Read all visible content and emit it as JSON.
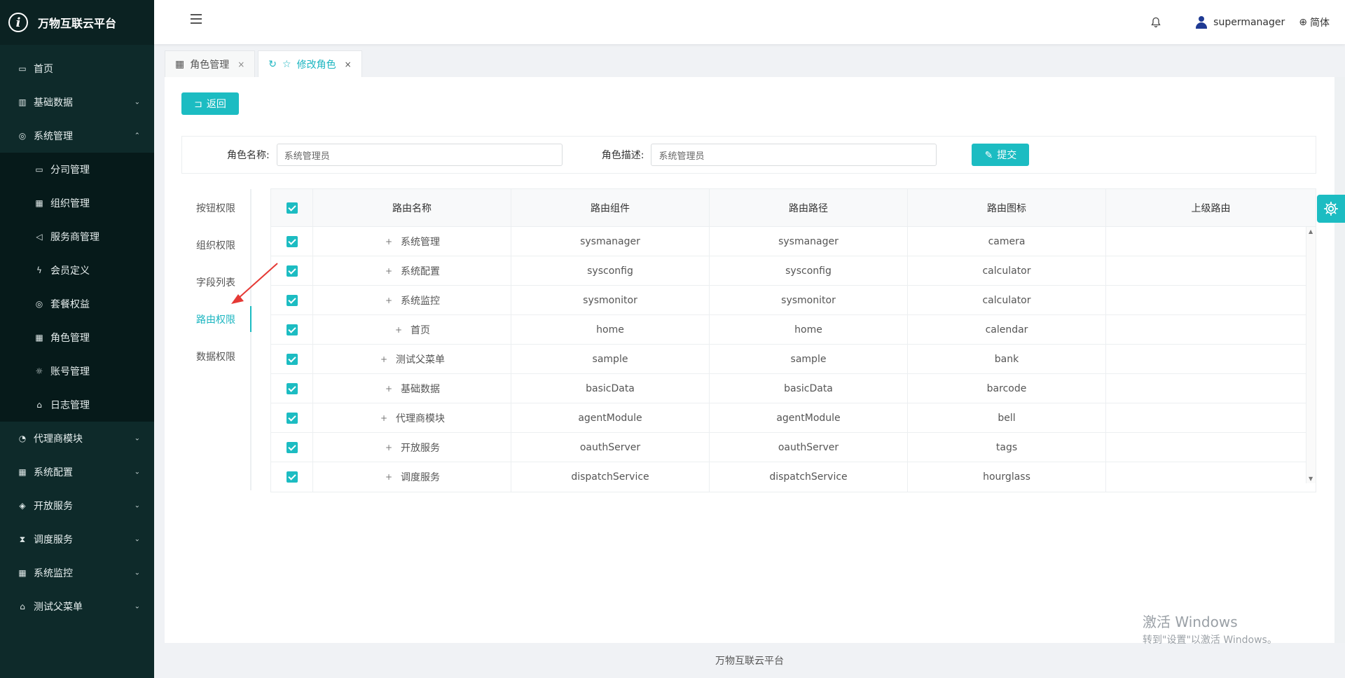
{
  "brand": {
    "logo_letter": "i",
    "title": "万物互联云平台"
  },
  "sidebar": {
    "items": [
      {
        "label": "首页",
        "icon": "calendar-icon",
        "glyph": "▭"
      },
      {
        "label": "基础数据",
        "icon": "barcode-icon",
        "glyph": "▥",
        "chevron": "⌄"
      },
      {
        "label": "系统管理",
        "icon": "camera-icon",
        "glyph": "◎",
        "chevron": "⌃",
        "expanded": true
      },
      {
        "label": "代理商模块",
        "icon": "bell-icon",
        "glyph": "◔",
        "chevron": "⌄"
      },
      {
        "label": "系统配置",
        "icon": "calculator-icon",
        "glyph": "▦",
        "chevron": "⌄"
      },
      {
        "label": "开放服务",
        "icon": "tags-icon",
        "glyph": "◈",
        "chevron": "⌄"
      },
      {
        "label": "调度服务",
        "icon": "hourglass-icon",
        "glyph": "⧗",
        "chevron": "⌄"
      },
      {
        "label": "系统监控",
        "icon": "calculator-icon",
        "glyph": "▦",
        "chevron": "⌄"
      },
      {
        "label": "测试父菜单",
        "icon": "bank-icon",
        "glyph": "⌂",
        "chevron": "⌄"
      }
    ],
    "submenu": [
      {
        "label": "分司管理",
        "icon": "calendar-icon",
        "glyph": "▭"
      },
      {
        "label": "组织管理",
        "icon": "calculator-icon",
        "glyph": "▦"
      },
      {
        "label": "服务商管理",
        "icon": "speaker-icon",
        "glyph": "◁"
      },
      {
        "label": "会员定义",
        "icon": "bolt-icon",
        "glyph": "ϟ"
      },
      {
        "label": "套餐权益",
        "icon": "camera-icon",
        "glyph": "◎"
      },
      {
        "label": "角色管理",
        "icon": "calculator-icon",
        "glyph": "▦"
      },
      {
        "label": "账号管理",
        "icon": "bug-icon",
        "glyph": "☼"
      },
      {
        "label": "日志管理",
        "icon": "home-icon",
        "glyph": "⌂"
      }
    ]
  },
  "header": {
    "username": "supermanager",
    "language": "简体",
    "globe_glyph": "⊕",
    "bell_glyph": "🔔"
  },
  "tabs": [
    {
      "label": "角色管理",
      "glyph": "▦",
      "close": "×"
    },
    {
      "label": "修改角色",
      "glyph": "☆",
      "refresh": "↻",
      "close": "×"
    }
  ],
  "actions": {
    "back_label": "返回",
    "back_glyph": "⊐",
    "submit_label": "提交",
    "submit_glyph": "✎"
  },
  "form": {
    "role_name_label": "角色名称:",
    "role_name_value": "系统管理员",
    "role_desc_label": "角色描述:",
    "role_desc_value": "系统管理员"
  },
  "perm_tabs": [
    "按钮权限",
    "组织权限",
    "字段列表",
    "路由权限",
    "数据权限"
  ],
  "active_perm_tab": "路由权限",
  "grid": {
    "headers": [
      "路由名称",
      "路由组件",
      "路由路径",
      "路由图标",
      "上级路由"
    ],
    "expand_glyph": "+",
    "rows": [
      {
        "name": "系统管理",
        "component": "sysmanager",
        "path": "sysmanager",
        "icon": "camera",
        "parent": ""
      },
      {
        "name": "系统配置",
        "component": "sysconfig",
        "path": "sysconfig",
        "icon": "calculator",
        "parent": ""
      },
      {
        "name": "系统监控",
        "component": "sysmonitor",
        "path": "sysmonitor",
        "icon": "calculator",
        "parent": ""
      },
      {
        "name": "首页",
        "component": "home",
        "path": "home",
        "icon": "calendar",
        "parent": ""
      },
      {
        "name": "测试父菜单",
        "component": "sample",
        "path": "sample",
        "icon": "bank",
        "parent": ""
      },
      {
        "name": "基础数据",
        "component": "basicData",
        "path": "basicData",
        "icon": "barcode",
        "parent": ""
      },
      {
        "name": "代理商模块",
        "component": "agentModule",
        "path": "agentModule",
        "icon": "bell",
        "parent": ""
      },
      {
        "name": "开放服务",
        "component": "oauthServer",
        "path": "oauthServer",
        "icon": "tags",
        "parent": ""
      },
      {
        "name": "调度服务",
        "component": "dispatchService",
        "path": "dispatchService",
        "icon": "hourglass",
        "parent": ""
      }
    ]
  },
  "watermark": {
    "line1": "激活 Windows",
    "line2": "转到\"设置\"以激活 Windows。"
  },
  "footer": {
    "text": "万物互联云平台"
  },
  "colors": {
    "accent": "#1cbcc2",
    "sidebar_bg": "#0e2a2a",
    "submenu_bg": "#061a1a"
  }
}
